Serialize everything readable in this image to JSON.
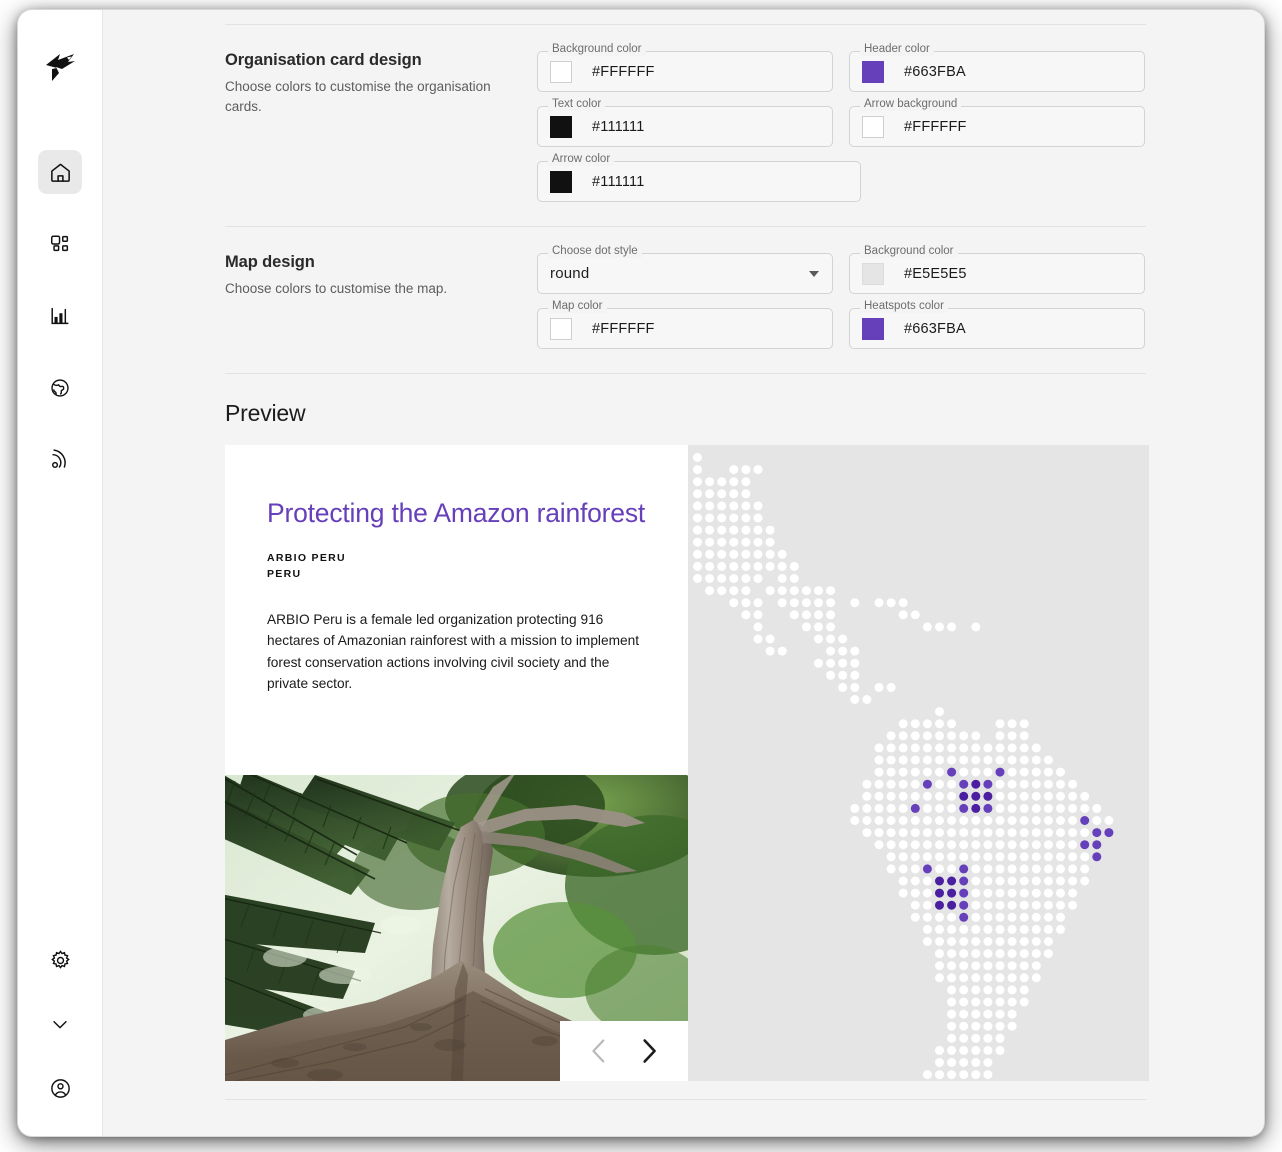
{
  "app": {
    "logo_icon": "origami-bird-logo"
  },
  "sidebar": {
    "top_items": [
      {
        "icon": "home-icon",
        "name": "home",
        "active": true
      },
      {
        "icon": "dashboard-grid-icon",
        "name": "dashboard",
        "active": false
      },
      {
        "icon": "bar-chart-icon",
        "name": "analytics",
        "active": false
      },
      {
        "icon": "globe-icon",
        "name": "globe",
        "active": false
      },
      {
        "icon": "broadcast-icon",
        "name": "broadcast",
        "active": false
      }
    ],
    "bottom_items": [
      {
        "icon": "gear-icon",
        "name": "settings"
      },
      {
        "icon": "chevron-down-icon",
        "name": "expand"
      },
      {
        "icon": "user-account-icon",
        "name": "account"
      }
    ]
  },
  "sections": [
    {
      "title": "Organisation card design",
      "description": "Choose colors to customise the organisation cards.",
      "fields": [
        {
          "label": "Background color",
          "value": "#FFFFFF",
          "swatch": "#FFFFFF",
          "type": "color"
        },
        {
          "label": "Header color",
          "value": "#663FBA",
          "swatch": "#663FBA",
          "type": "color"
        },
        {
          "label": "Text color",
          "value": "#111111",
          "swatch": "#111111",
          "type": "color"
        },
        {
          "label": "Arrow background",
          "value": "#FFFFFF",
          "swatch": "#FFFFFF",
          "type": "color"
        },
        {
          "label": "Arrow color",
          "value": "#111111",
          "swatch": "#111111",
          "type": "color"
        }
      ]
    },
    {
      "title": "Map design",
      "description": "Choose colors to customise the map.",
      "fields": [
        {
          "label": "Choose dot style",
          "value": "round",
          "type": "select"
        },
        {
          "label": "Background color",
          "value": "#E5E5E5",
          "swatch": "#E5E5E5",
          "type": "color"
        },
        {
          "label": "Map color",
          "value": "#FFFFFF",
          "swatch": "#FFFFFF",
          "type": "color"
        },
        {
          "label": "Heatspots color",
          "value": "#663FBA",
          "swatch": "#663FBA",
          "type": "color"
        }
      ]
    }
  ],
  "preview": {
    "heading": "Preview",
    "card": {
      "title": "Protecting the Amazon rainforest",
      "org_name": "ARBIO PERU",
      "country": "PERU",
      "description": "ARBIO Peru is a female led organization protecting 916 hectares of Amazonian rainforest with a mission to implement forest conservation actions involving civil society and the private sector.",
      "photo_alt": "rainforest-canopy-photo",
      "prev_icon": "chevron-left-icon",
      "next_icon": "chevron-right-icon",
      "prev_enabled": false,
      "next_enabled": true
    },
    "map": {
      "background_color": "#E5E5E5",
      "dot_color": "#FFFFFF",
      "heatspot_color": "#663FBA",
      "heatspot_strong_color": "#4A1FA0",
      "dot_style": "round"
    }
  }
}
